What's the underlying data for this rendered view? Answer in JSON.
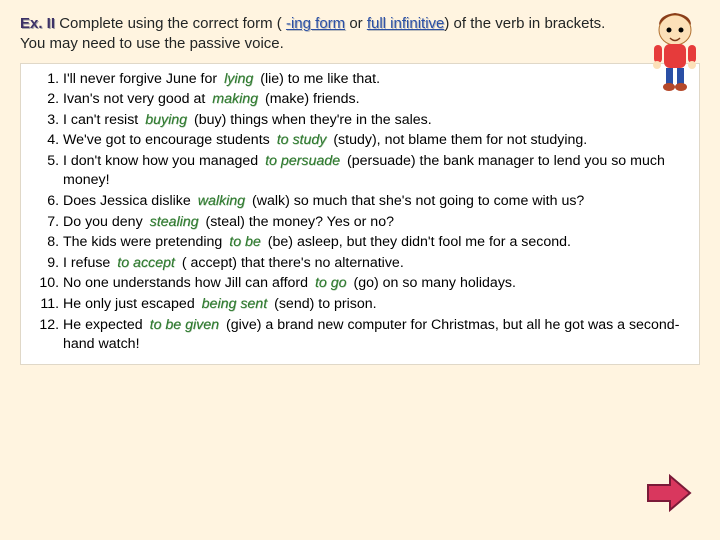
{
  "instruction": {
    "exLabel": "Ex. II",
    "part1": "  Complete using the correct form (",
    "ingForm": "-ing form",
    "or": " or ",
    "fullInf": "full infinitive",
    "part2": ") of the verb in brackets. You may need to use the passive voice."
  },
  "items": [
    {
      "pre": "I'll never forgive June for",
      "ans": "lying",
      "post": "(lie) to me like that."
    },
    {
      "pre": "Ivan's not very good at",
      "ans": "making",
      "post": "(make) friends."
    },
    {
      "pre": "I can't resist",
      "ans": "buying",
      "post": "(buy) things when they're in the sales."
    },
    {
      "pre": "We've got to encourage students",
      "ans": "to study",
      "post": "(study), not blame them for not studying."
    },
    {
      "pre": "I don't know how you managed",
      "ans": "to persuade",
      "post": "(persuade) the bank manager to lend you so much money!"
    },
    {
      "pre": "Does Jessica dislike",
      "ans": "walking",
      "post": "(walk) so much that she's not going to come with us?"
    },
    {
      "pre": "Do you deny",
      "ans": "stealing",
      "post": "(steal) the money? Yes or no?"
    },
    {
      "pre": "The kids were  pretending",
      "ans": "to be",
      "post": "(be) asleep, but they didn't fool me for a second."
    },
    {
      "pre": "I refuse",
      "ans": "to accept",
      "post": "( accept) that there's no alternative."
    },
    {
      "pre": "No one understands how Jill can afford",
      "ans": "to go",
      "post": "(go) on so many holidays."
    },
    {
      "pre": "He only just escaped",
      "ans": "being sent",
      "post": "(send) to prison."
    },
    {
      "pre": "He expected",
      "ans": "to be given",
      "post": "(give) a brand new computer for Christmas, but all he got was a second-hand watch!"
    }
  ]
}
